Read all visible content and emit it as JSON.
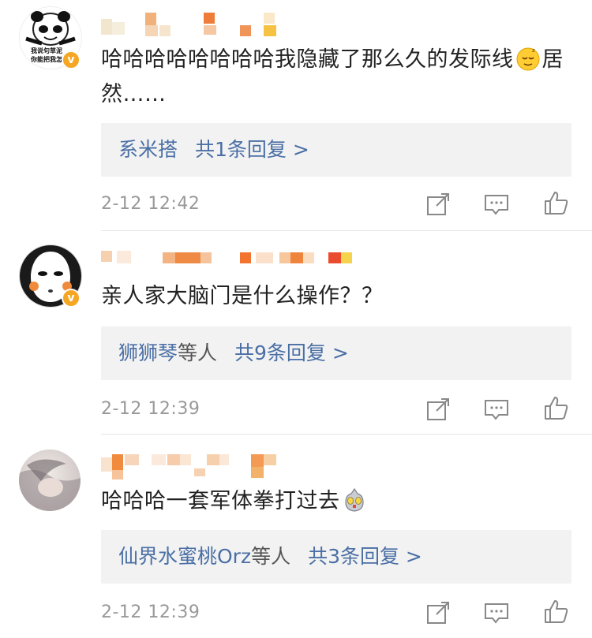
{
  "comments": [
    {
      "text_before_emoji": "哈哈哈哈哈哈哈哈我隐藏了那么久的发际线",
      "text_after_emoji": "居然……",
      "emoji": "sleepy-face-icon",
      "avatar_caption_1": "我说句草泥",
      "avatar_caption_2": "你能把我怎",
      "reply_user": "系米搭",
      "reply_count": "共1条回复 >",
      "time": "2-12 12:42"
    },
    {
      "text": "亲人家大脑门是什么操作？？",
      "reply_user": "狮狮琴",
      "reply_suffix": "等人",
      "reply_count": "共9条回复 >",
      "time": "2-12 12:39"
    },
    {
      "text": "哈哈哈一套军体拳打过去",
      "emoji": "ultraman-icon",
      "reply_user": "仙界水蜜桃Orz",
      "reply_suffix": "等人",
      "reply_count": "共3条回复 >",
      "time": "2-12 12:39"
    }
  ],
  "colors": {
    "link": "#4a6fa5",
    "verified": "#f5a623",
    "time": "#999999",
    "reply_bg": "#f2f2f2"
  }
}
